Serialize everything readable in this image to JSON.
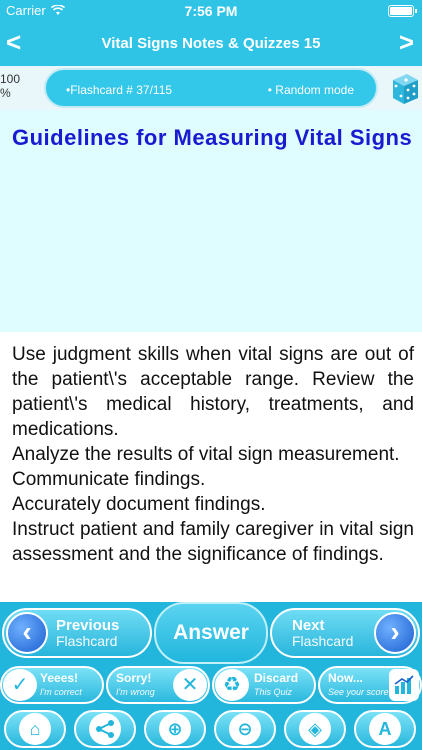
{
  "status_bar": {
    "carrier": "Carrier",
    "time": "7:56 PM"
  },
  "nav": {
    "back": "<",
    "title": "Vital Signs Notes & Quizzes 15",
    "forward": ">"
  },
  "info": {
    "progress": "100\n%",
    "flashcard": "•Flashcard # 37/115",
    "mode": "• Random mode"
  },
  "card": {
    "title": "Guidelines for Measuring Vital Signs",
    "answer": "Use judgment skills when vital signs are out of the patient\\'s acceptable range. Review the patient\\'s medical history, treatments, and medications.\n  Analyze the results of vital sign measurement.\n Communicate findings.\n Accurately document findings.\n Instruct patient and family caregiver in vital sign assessment and the significance of findings."
  },
  "controls": {
    "previous": {
      "label": "Previous",
      "sub": "Flashcard"
    },
    "answer": "Answer",
    "next": {
      "label": "Next",
      "sub": "Flashcard"
    },
    "yes": {
      "label": "Yeees!",
      "sub": "I'm correct"
    },
    "sorry": {
      "label": "Sorry!",
      "sub": "I'm wrong"
    },
    "discard": {
      "label": "Discard",
      "sub": "This Quiz"
    },
    "now": {
      "label": "Now...",
      "sub": "See your score"
    }
  },
  "colors": {
    "accent": "#2fc3e6",
    "title_blue": "#1a1ad0",
    "card_bg": "#dffcff"
  }
}
